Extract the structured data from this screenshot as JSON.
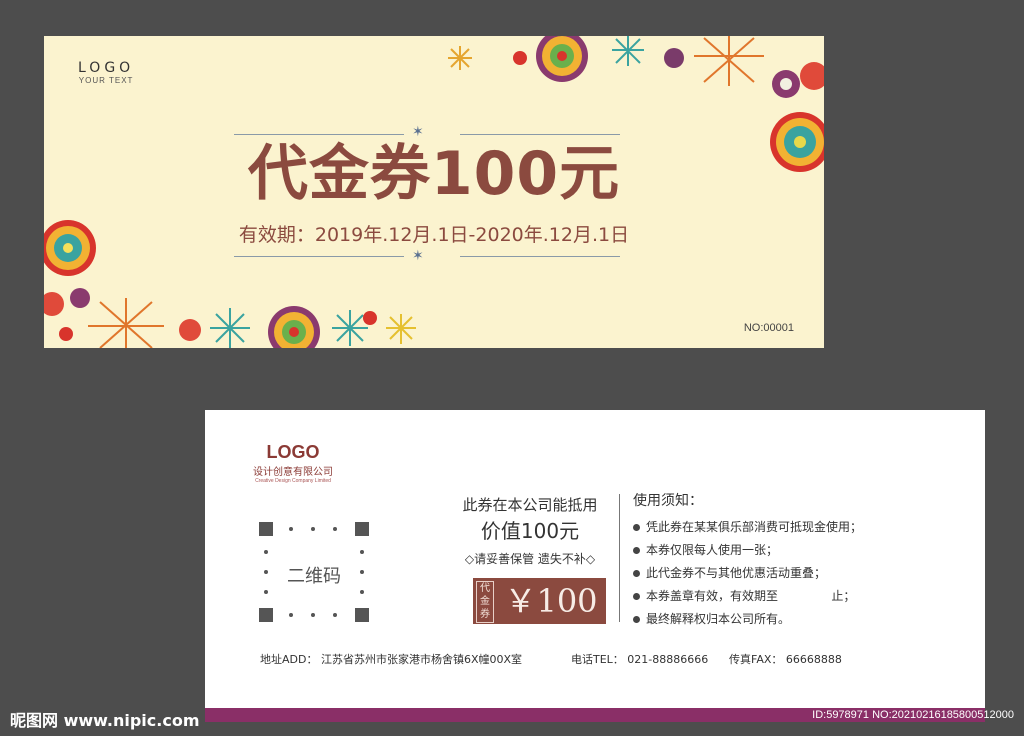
{
  "front": {
    "logo": "LOGO",
    "logo_sub": "YOUR TEXT",
    "title": "代金券100元",
    "validity": "有效期：2019年.12月.1日-2020年.12月.1日",
    "serial": "NO:00001",
    "colors": {
      "background": "#fbf3cf",
      "title": "#8b4a3f"
    }
  },
  "back": {
    "logo": "LOGO",
    "company": "设计创意有限公司",
    "company_en": "Creative Design Company Limited",
    "qr_label": "二维码",
    "use_line": "此券在本公司能抵用",
    "value_line": "价值100元",
    "keep_line": "◇请妥善保管 遗失不补◇",
    "price_tag": "代金券",
    "price": "￥100",
    "notes_title": "使用须知：",
    "notes": [
      "凭此券在某某俱乐部消费可抵现金使用；",
      "本券仅限每人使用一张；",
      "此代金券不与其他优惠活动重叠；",
      "本券盖章有效，有效期至              止；",
      "最终解释权归本公司所有。"
    ],
    "address": "地址ADD：  江苏省苏州市张家港市杨舍镇6X幢00X室",
    "phone": "电话TEL：  021-88886666",
    "fax": "传真FAX：  66668888",
    "colors": {
      "accent": "#8b4a3f",
      "strip": "#8a2f67"
    }
  },
  "watermark": {
    "site": "昵图网 www.nipic.com",
    "id": "ID:5978971 NO:20210216185800512000"
  }
}
